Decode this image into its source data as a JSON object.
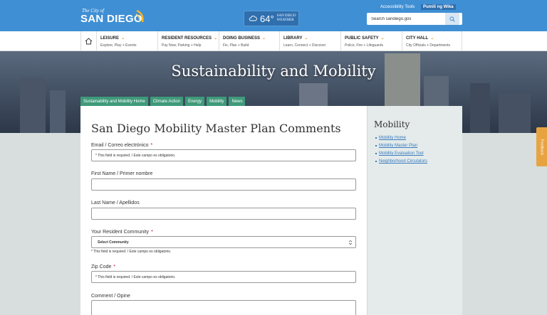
{
  "header": {
    "logo_small": "The City of",
    "logo_big": "SAN DIEGO",
    "weather_temp": "64°",
    "weather_loc1": "San Diego",
    "weather_loc2": "Weather",
    "accessibility": "Accessibility Tools",
    "language": "Pumili ng Wika",
    "search_placeholder": "Search sandiego.gov"
  },
  "nav": {
    "items": [
      {
        "title": "LEISURE",
        "sub": "Explore, Play + Events"
      },
      {
        "title": "RESIDENT RESOURCES",
        "sub": "Pay Now, Parking + Help"
      },
      {
        "title": "DOING BUSINESS",
        "sub": "Fix, Plan + Build"
      },
      {
        "title": "LIBRARY",
        "sub": "Learn, Connect + Discover"
      },
      {
        "title": "PUBLIC SAFETY",
        "sub": "Police, Fire + Lifeguards"
      },
      {
        "title": "CITY HALL",
        "sub": "City Officials + Departments"
      }
    ]
  },
  "hero": {
    "title": "Sustainability and Mobility",
    "tabs": [
      "Sustainability and Mobility Home",
      "Climate Action",
      "Energy",
      "Mobility",
      "News"
    ]
  },
  "form": {
    "title": "San Diego Mobility Master Plan Comments",
    "email_label": "Email / Correo electrónico",
    "required_msg": "* This field is required. / Este campo es obligatorio.",
    "first_name_label": "First Name / Primer nombre",
    "last_name_label": "Last Name / Apellidos",
    "community_label": "Your Resident Community",
    "community_value": "Select Community",
    "zip_label": "Zip Code",
    "comment_label": "Comment / Opine",
    "required_mark": "*"
  },
  "sidebar": {
    "title": "Mobility",
    "links": [
      "Mobility Home",
      "Mobility Master Plan",
      "Mobility Evaluation Tool",
      "Neighborhood Circulators"
    ]
  },
  "feedback": "Feedback",
  "colors": {
    "header_blue": "#3f8fd4",
    "tab_green": "#3f9a7a",
    "accent_orange": "#e29a1f",
    "link_blue": "#3a7bbf"
  }
}
